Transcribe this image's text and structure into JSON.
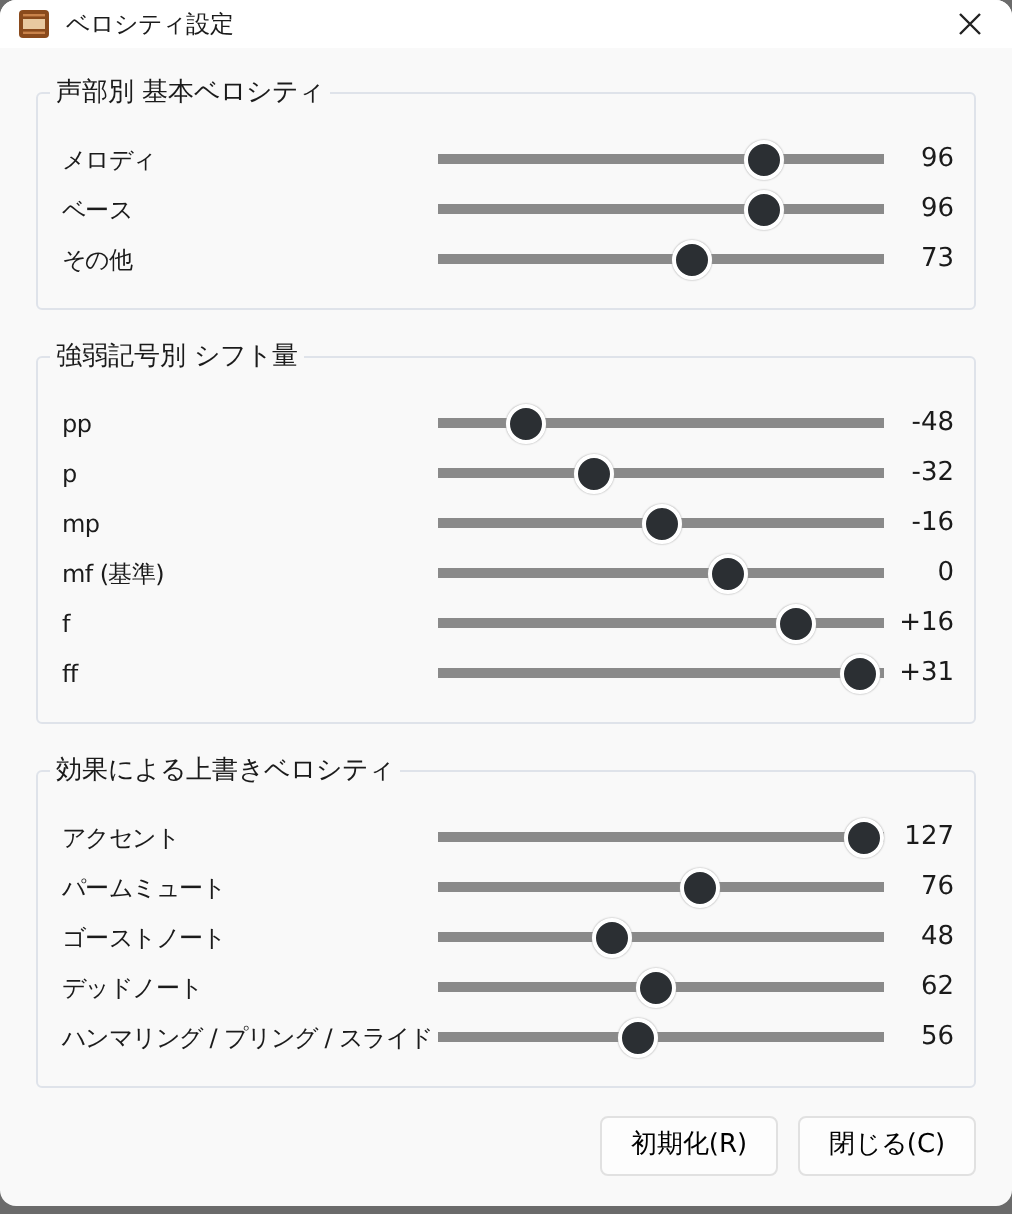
{
  "window": {
    "title": "ベロシティ設定"
  },
  "groups": [
    {
      "title": "声部別 基本ベロシティ",
      "rows": [
        {
          "label": "メロディ",
          "value": "96",
          "level": 0.756
        },
        {
          "label": "ベース",
          "value": "96",
          "level": 0.756
        },
        {
          "label": "その他",
          "value": "73",
          "level": 0.575
        }
      ]
    },
    {
      "title": "強弱記号別 シフト量",
      "rows": [
        {
          "label": "pp",
          "value": "-48",
          "level": 0.167
        },
        {
          "label": "p",
          "value": "-32",
          "level": 0.333
        },
        {
          "label": "mp",
          "value": "-16",
          "level": 0.5
        },
        {
          "label": "mf (基準)",
          "value": "0",
          "level": 0.667
        },
        {
          "label": "f",
          "value": "+16",
          "level": 0.833
        },
        {
          "label": "ff",
          "value": "+31",
          "level": 0.99
        }
      ]
    },
    {
      "title": "効果による上書きベロシティ",
      "rows": [
        {
          "label": "アクセント",
          "value": "127",
          "level": 1.0
        },
        {
          "label": "パームミュート",
          "value": "76",
          "level": 0.598
        },
        {
          "label": "ゴーストノート",
          "value": "48",
          "level": 0.378
        },
        {
          "label": "デッドノート",
          "value": "62",
          "level": 0.488
        },
        {
          "label": "ハンマリング / プリング / スライド",
          "value": "56",
          "level": 0.441
        }
      ]
    }
  ],
  "buttons": [
    "初期化(R)",
    "閉じる(C)"
  ]
}
